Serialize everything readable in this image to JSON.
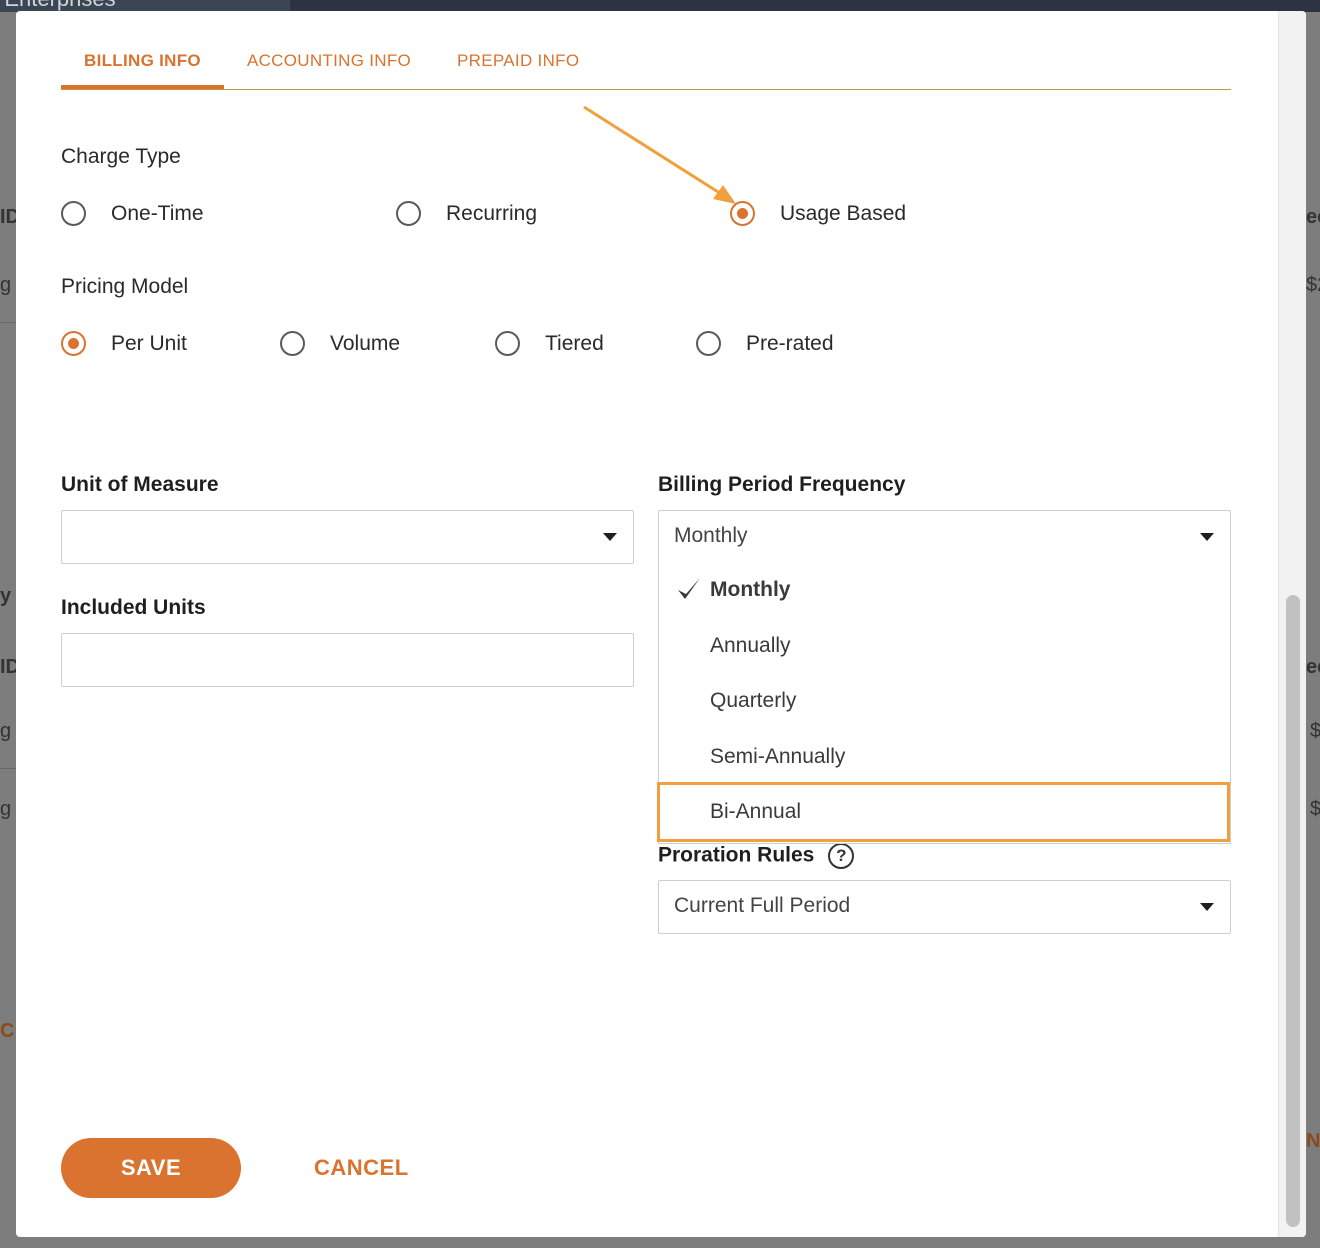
{
  "background": {
    "title_fragment": "e Enterprises",
    "frag_id_1": "ID",
    "frag_g_1": "g",
    "frag_y": "y",
    "frag_id_2": "ID",
    "frag_g_2": "g",
    "frag_g_3": "g",
    "frag_c": "C",
    "frag_ec_1": "ec",
    "frag_s2": "$2",
    "frag_ec_2": "ec",
    "frag_dollar_1": "$",
    "frag_dollar_2": "$",
    "frag_n": "N"
  },
  "tabs": [
    {
      "label": "BILLING INFO",
      "active": true
    },
    {
      "label": "ACCOUNTING INFO",
      "active": false
    },
    {
      "label": "PREPAID INFO",
      "active": false
    }
  ],
  "charge_type": {
    "label": "Charge Type",
    "options": [
      "One-Time",
      "Recurring",
      "Usage Based"
    ],
    "selected": "Usage Based"
  },
  "pricing_model": {
    "label": "Pricing Model",
    "options": [
      "Per Unit",
      "Volume",
      "Tiered",
      "Pre-rated"
    ],
    "selected": "Per Unit"
  },
  "unit_of_measure": {
    "label": "Unit of Measure",
    "value": ""
  },
  "included_units": {
    "label": "Included Units",
    "value": ""
  },
  "billing_period_frequency": {
    "label": "Billing Period Frequency",
    "value": "Monthly",
    "options": [
      "Monthly",
      "Annually",
      "Quarterly",
      "Semi-Annually",
      "Bi-Annual"
    ],
    "highlighted": "Bi-Annual"
  },
  "proration_rules": {
    "label": "Proration Rules",
    "help": "?",
    "value": "Current Full Period"
  },
  "buttons": {
    "save": "SAVE",
    "cancel": "CANCEL"
  },
  "colors": {
    "accent": "#d9732f",
    "annotation": "#f0a03c"
  }
}
